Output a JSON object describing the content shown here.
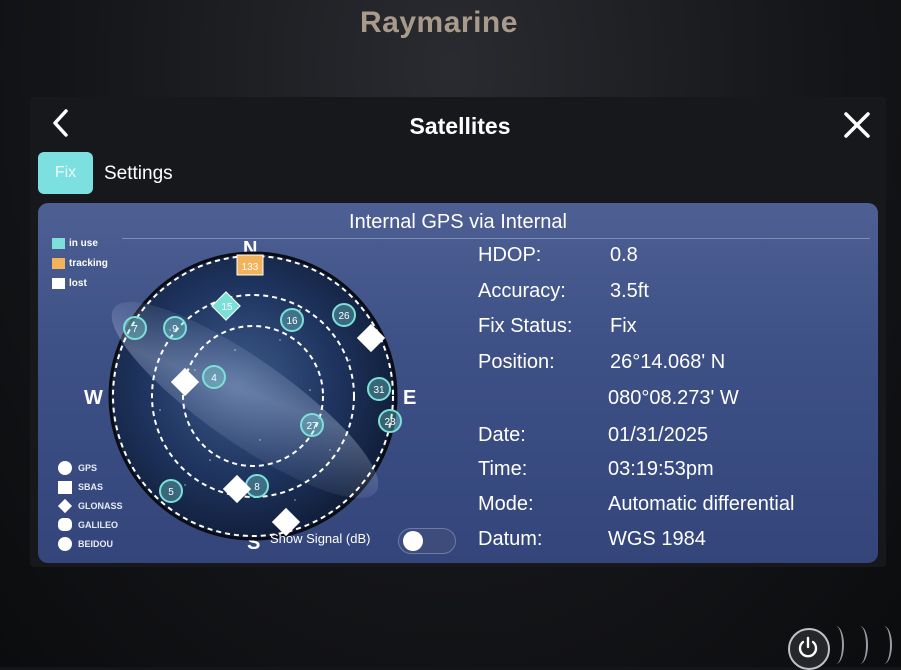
{
  "device": {
    "brand": "Raymarine"
  },
  "header": {
    "title": "Satellites",
    "back_icon": "chevron-left-icon",
    "close_icon": "close-icon"
  },
  "tabs": [
    {
      "label": "Fix",
      "active": true
    },
    {
      "label": "Settings",
      "active": false
    }
  ],
  "panel": {
    "title": "Internal GPS via Internal"
  },
  "status_legend": [
    {
      "label": "in use",
      "color": "#7ce0d8"
    },
    {
      "label": "tracking",
      "color": "#f2b35a"
    },
    {
      "label": "lost",
      "color": "#ffffff"
    }
  ],
  "constellation_legend": [
    {
      "label": "GPS",
      "shape": "circle"
    },
    {
      "label": "SBAS",
      "shape": "square"
    },
    {
      "label": "GLONASS",
      "shape": "diamond"
    },
    {
      "label": "GALILEO",
      "shape": "rounded-square"
    },
    {
      "label": "BEIDOU",
      "shape": "circle"
    }
  ],
  "compass": {
    "n": "N",
    "s": "S",
    "e": "E",
    "w": "W"
  },
  "satellites": [
    {
      "id": "133",
      "type": "SBAS",
      "status": "tracking"
    },
    {
      "id": "15",
      "type": "GLONASS",
      "status": "in use"
    },
    {
      "id": "16",
      "type": "GPS",
      "status": "in use"
    },
    {
      "id": "26",
      "type": "GPS",
      "status": "in use"
    },
    {
      "id": "7",
      "type": "GPS",
      "status": "in use"
    },
    {
      "id": "9",
      "type": "GPS",
      "status": "in use"
    },
    {
      "id": "4",
      "type": "GPS",
      "status": "in use"
    },
    {
      "id": "31",
      "type": "GPS",
      "status": "in use"
    },
    {
      "id": "27",
      "type": "GPS",
      "status": "in use"
    },
    {
      "id": "28",
      "type": "GPS",
      "status": "in use"
    },
    {
      "id": "8",
      "type": "GPS",
      "status": "in use"
    },
    {
      "id": "5",
      "type": "GPS",
      "status": "in use"
    },
    {
      "id": "",
      "type": "GLONASS",
      "status": "lost"
    },
    {
      "id": "",
      "type": "GLONASS",
      "status": "lost"
    },
    {
      "id": "",
      "type": "GLONASS",
      "status": "lost"
    },
    {
      "id": "",
      "type": "GLONASS",
      "status": "lost"
    }
  ],
  "toggle": {
    "label": "Show Signal (dB)",
    "on": false
  },
  "fix_info": [
    {
      "label": "HDOP:",
      "value": "0.8"
    },
    {
      "label": "Accuracy:",
      "value": "3.5ft"
    },
    {
      "label": "Fix Status:",
      "value": "Fix"
    },
    {
      "label": "Position:",
      "value": "26°14.068' N"
    },
    {
      "label": "",
      "value": "080°08.273' W"
    },
    {
      "label": "Date:",
      "value": "01/31/2025"
    },
    {
      "label": "Time:",
      "value": "03:19:53pm"
    },
    {
      "label": "Mode:",
      "value": "Automatic differential"
    },
    {
      "label": "Datum:",
      "value": "WGS 1984"
    }
  ],
  "power_icon": "power-icon"
}
